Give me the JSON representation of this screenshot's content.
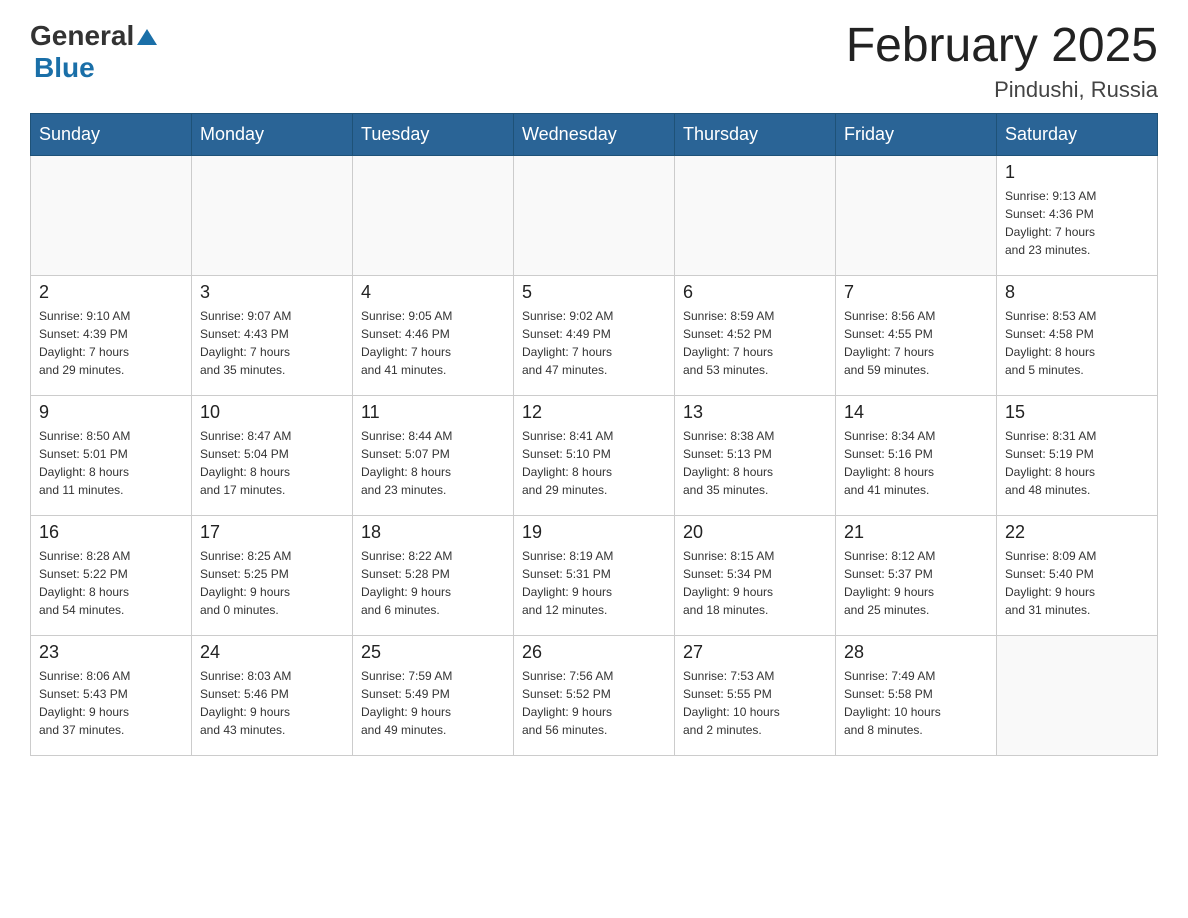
{
  "header": {
    "logo_general": "General",
    "logo_blue": "Blue",
    "title": "February 2025",
    "subtitle": "Pindushi, Russia"
  },
  "weekdays": [
    "Sunday",
    "Monday",
    "Tuesday",
    "Wednesday",
    "Thursday",
    "Friday",
    "Saturday"
  ],
  "weeks": [
    [
      {
        "day": "",
        "info": ""
      },
      {
        "day": "",
        "info": ""
      },
      {
        "day": "",
        "info": ""
      },
      {
        "day": "",
        "info": ""
      },
      {
        "day": "",
        "info": ""
      },
      {
        "day": "",
        "info": ""
      },
      {
        "day": "1",
        "info": "Sunrise: 9:13 AM\nSunset: 4:36 PM\nDaylight: 7 hours\nand 23 minutes."
      }
    ],
    [
      {
        "day": "2",
        "info": "Sunrise: 9:10 AM\nSunset: 4:39 PM\nDaylight: 7 hours\nand 29 minutes."
      },
      {
        "day": "3",
        "info": "Sunrise: 9:07 AM\nSunset: 4:43 PM\nDaylight: 7 hours\nand 35 minutes."
      },
      {
        "day": "4",
        "info": "Sunrise: 9:05 AM\nSunset: 4:46 PM\nDaylight: 7 hours\nand 41 minutes."
      },
      {
        "day": "5",
        "info": "Sunrise: 9:02 AM\nSunset: 4:49 PM\nDaylight: 7 hours\nand 47 minutes."
      },
      {
        "day": "6",
        "info": "Sunrise: 8:59 AM\nSunset: 4:52 PM\nDaylight: 7 hours\nand 53 minutes."
      },
      {
        "day": "7",
        "info": "Sunrise: 8:56 AM\nSunset: 4:55 PM\nDaylight: 7 hours\nand 59 minutes."
      },
      {
        "day": "8",
        "info": "Sunrise: 8:53 AM\nSunset: 4:58 PM\nDaylight: 8 hours\nand 5 minutes."
      }
    ],
    [
      {
        "day": "9",
        "info": "Sunrise: 8:50 AM\nSunset: 5:01 PM\nDaylight: 8 hours\nand 11 minutes."
      },
      {
        "day": "10",
        "info": "Sunrise: 8:47 AM\nSunset: 5:04 PM\nDaylight: 8 hours\nand 17 minutes."
      },
      {
        "day": "11",
        "info": "Sunrise: 8:44 AM\nSunset: 5:07 PM\nDaylight: 8 hours\nand 23 minutes."
      },
      {
        "day": "12",
        "info": "Sunrise: 8:41 AM\nSunset: 5:10 PM\nDaylight: 8 hours\nand 29 minutes."
      },
      {
        "day": "13",
        "info": "Sunrise: 8:38 AM\nSunset: 5:13 PM\nDaylight: 8 hours\nand 35 minutes."
      },
      {
        "day": "14",
        "info": "Sunrise: 8:34 AM\nSunset: 5:16 PM\nDaylight: 8 hours\nand 41 minutes."
      },
      {
        "day": "15",
        "info": "Sunrise: 8:31 AM\nSunset: 5:19 PM\nDaylight: 8 hours\nand 48 minutes."
      }
    ],
    [
      {
        "day": "16",
        "info": "Sunrise: 8:28 AM\nSunset: 5:22 PM\nDaylight: 8 hours\nand 54 minutes."
      },
      {
        "day": "17",
        "info": "Sunrise: 8:25 AM\nSunset: 5:25 PM\nDaylight: 9 hours\nand 0 minutes."
      },
      {
        "day": "18",
        "info": "Sunrise: 8:22 AM\nSunset: 5:28 PM\nDaylight: 9 hours\nand 6 minutes."
      },
      {
        "day": "19",
        "info": "Sunrise: 8:19 AM\nSunset: 5:31 PM\nDaylight: 9 hours\nand 12 minutes."
      },
      {
        "day": "20",
        "info": "Sunrise: 8:15 AM\nSunset: 5:34 PM\nDaylight: 9 hours\nand 18 minutes."
      },
      {
        "day": "21",
        "info": "Sunrise: 8:12 AM\nSunset: 5:37 PM\nDaylight: 9 hours\nand 25 minutes."
      },
      {
        "day": "22",
        "info": "Sunrise: 8:09 AM\nSunset: 5:40 PM\nDaylight: 9 hours\nand 31 minutes."
      }
    ],
    [
      {
        "day": "23",
        "info": "Sunrise: 8:06 AM\nSunset: 5:43 PM\nDaylight: 9 hours\nand 37 minutes."
      },
      {
        "day": "24",
        "info": "Sunrise: 8:03 AM\nSunset: 5:46 PM\nDaylight: 9 hours\nand 43 minutes."
      },
      {
        "day": "25",
        "info": "Sunrise: 7:59 AM\nSunset: 5:49 PM\nDaylight: 9 hours\nand 49 minutes."
      },
      {
        "day": "26",
        "info": "Sunrise: 7:56 AM\nSunset: 5:52 PM\nDaylight: 9 hours\nand 56 minutes."
      },
      {
        "day": "27",
        "info": "Sunrise: 7:53 AM\nSunset: 5:55 PM\nDaylight: 10 hours\nand 2 minutes."
      },
      {
        "day": "28",
        "info": "Sunrise: 7:49 AM\nSunset: 5:58 PM\nDaylight: 10 hours\nand 8 minutes."
      },
      {
        "day": "",
        "info": ""
      }
    ]
  ]
}
